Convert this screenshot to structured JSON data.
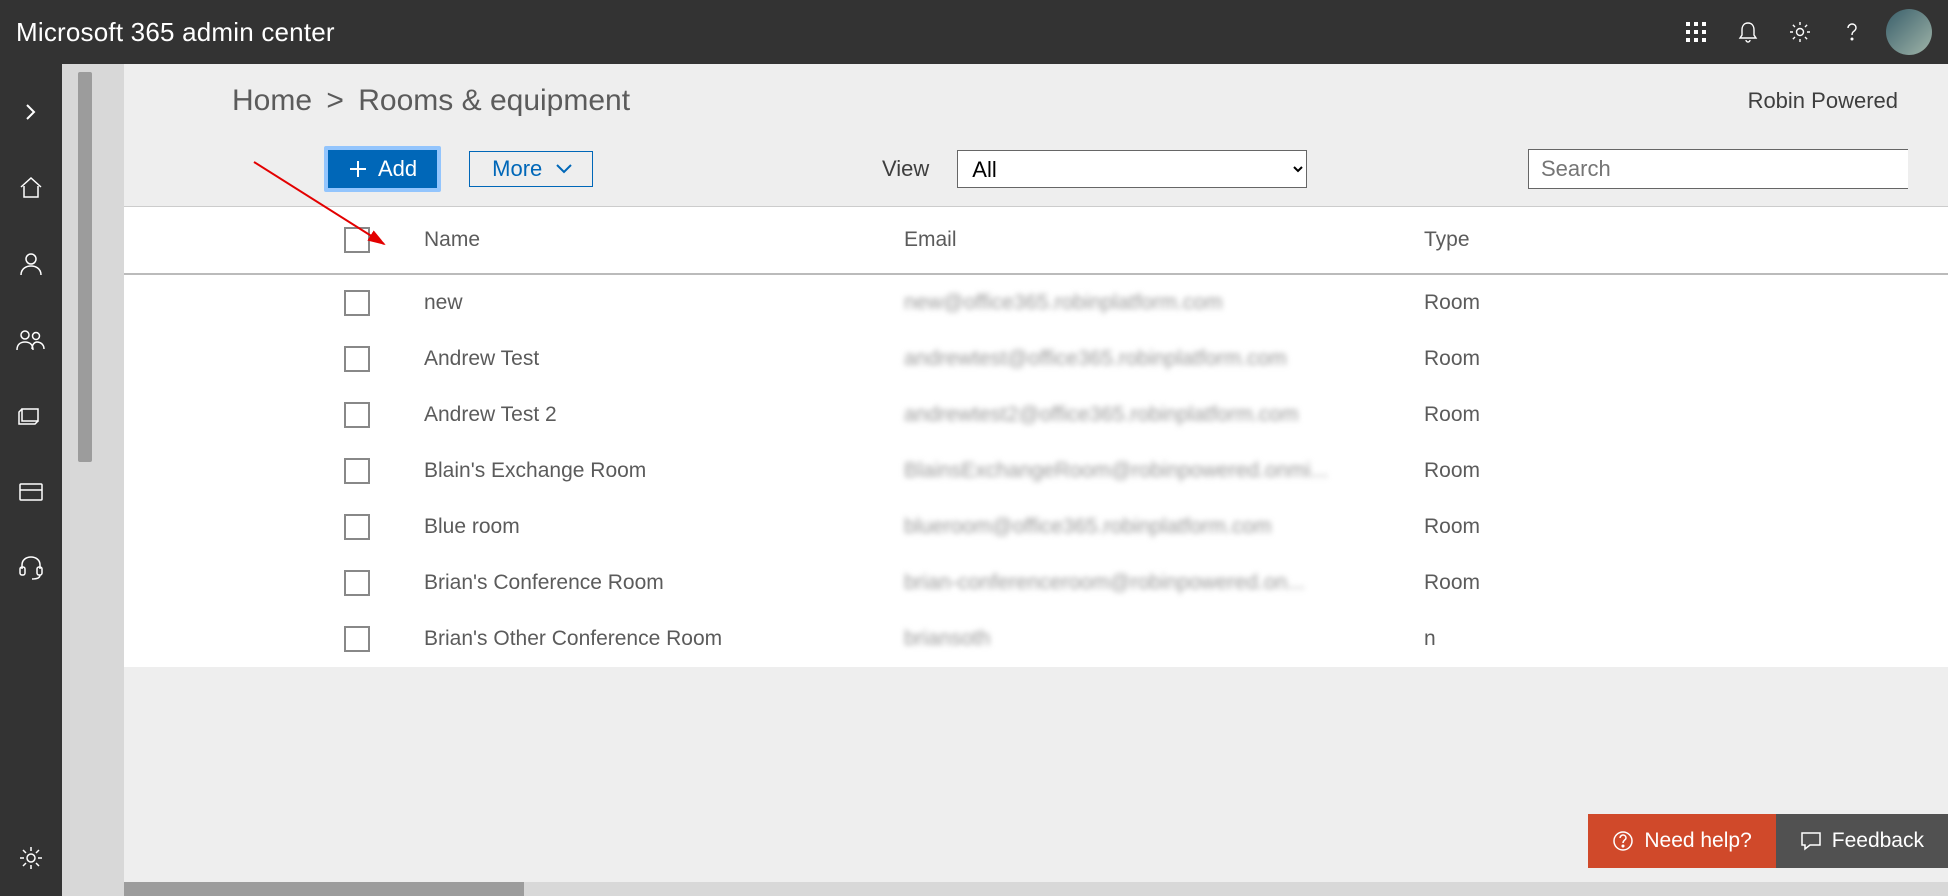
{
  "topbar": {
    "title": "Microsoft 365 admin center"
  },
  "breadcrumb": {
    "home": "Home",
    "sep": ">",
    "current": "Rooms & equipment"
  },
  "org_name": "Robin Powered",
  "toolbar": {
    "add_label": "Add",
    "more_label": "More",
    "view_label": "View",
    "view_value": "All",
    "search_placeholder": "Search"
  },
  "columns": {
    "name": "Name",
    "email": "Email",
    "type": "Type"
  },
  "rows": [
    {
      "name": "new",
      "email": "new@office365.robinplatform.com",
      "type": "Room"
    },
    {
      "name": "Andrew Test",
      "email": "andrewtest@office365.robinplatform.com",
      "type": "Room"
    },
    {
      "name": "Andrew Test 2",
      "email": "andrewtest2@office365.robinplatform.com",
      "type": "Room"
    },
    {
      "name": "Blain's Exchange Room",
      "email": "BlainsExchangeRoom@robinpowered.onmi...",
      "type": "Room"
    },
    {
      "name": "Blue room",
      "email": "blueroom@office365.robinplatform.com",
      "type": "Room"
    },
    {
      "name": "Brian's Conference Room",
      "email": "brian-conferenceroom@robinpowered.on...",
      "type": "Room"
    },
    {
      "name": "Brian's Other Conference Room",
      "email": "briansoth",
      "type": "n"
    }
  ],
  "bottom": {
    "help": "Need help?",
    "feedback": "Feedback"
  }
}
